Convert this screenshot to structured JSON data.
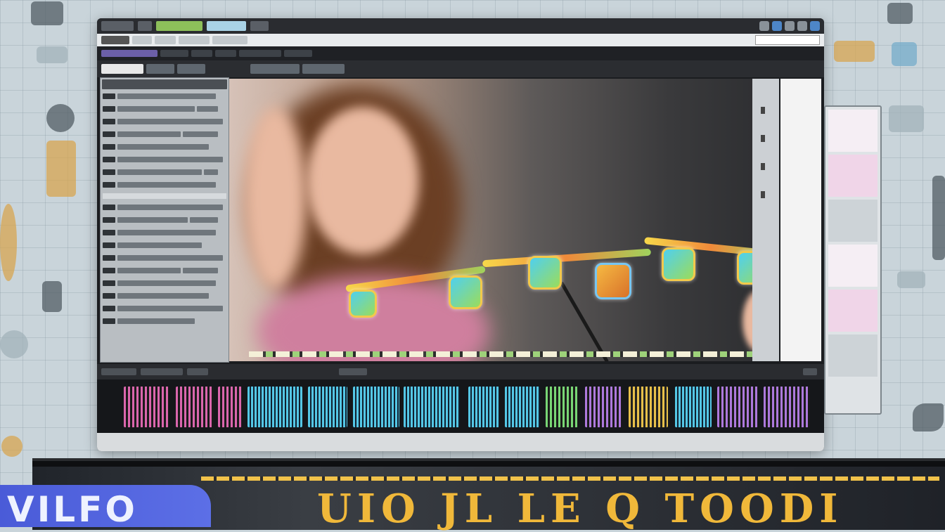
{
  "tv": {
    "title": "UIO JL LE Q TOODI"
  },
  "badge": {
    "text": "VILFO"
  },
  "colors": {
    "accent": "#f0b83a",
    "badge": "#4a5bd8",
    "clip_pink": "#e46ab5",
    "clip_cyan": "#58d0f0",
    "clip_purple": "#b57ee6",
    "clip_green": "#7ee07a"
  }
}
